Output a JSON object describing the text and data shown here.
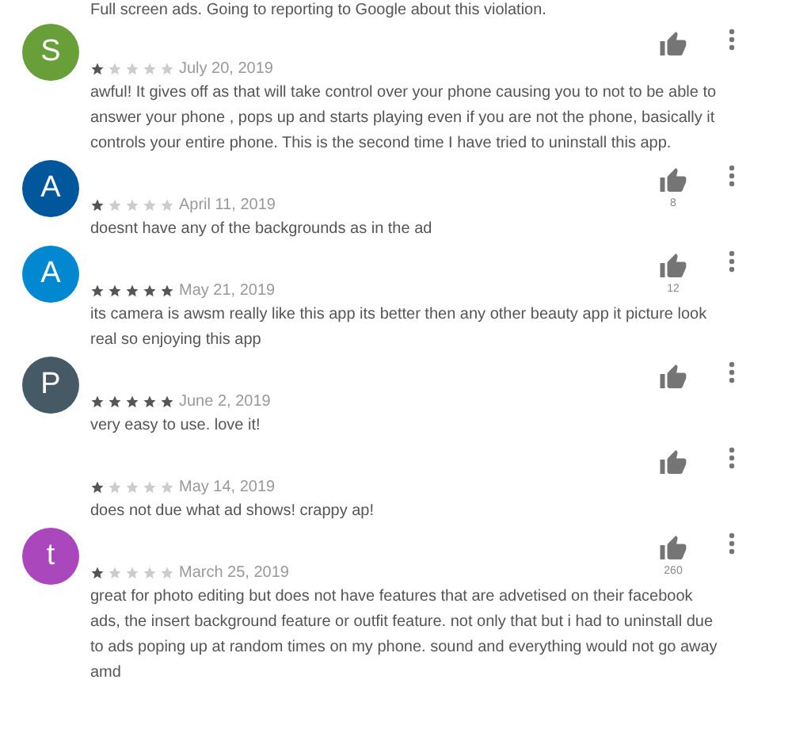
{
  "top_text": "Full screen ads. Going to reporting to Google about this violation.",
  "reviews": [
    {
      "initial": "S",
      "color": "#689f38",
      "stars": 1,
      "date": "July 20, 2019",
      "text": "awful! It gives off as that will take control over your phone causing you to not to be able to answer your phone , pops up and starts playing even if you are not the phone, basically it controls your entire phone. This is the second time I have tried to uninstall this app."
    },
    {
      "initial": "A",
      "color": "#01579b",
      "stars": 1,
      "date": "April 11, 2019",
      "likes": "8",
      "text": "doesnt have any of the backgrounds as in the ad"
    },
    {
      "initial": "A",
      "color": "#0288d1",
      "stars": 5,
      "date": "May 21, 2019",
      "likes": "12",
      "text": "its camera is awsm really like this app its better then any other beauty app it picture look real so enjoying this app"
    },
    {
      "initial": "P",
      "color": "#455a64",
      "stars": 5,
      "date": "June 2, 2019",
      "text": "very easy to use. love it!"
    },
    {
      "stars": 1,
      "date": "May 14, 2019",
      "text": "does not due what ad shows! crappy ap!"
    },
    {
      "initial": "t",
      "color": "#ab47bc",
      "stars": 1,
      "date": "March 25, 2019",
      "likes": "260",
      "text": "great for photo editing but does not have features that are advetised on their facebook ads, the insert background feature or outfit feature. not only that but i had to uninstall due to ads poping up at random times on my phone. sound and everything would not go away amd"
    }
  ]
}
